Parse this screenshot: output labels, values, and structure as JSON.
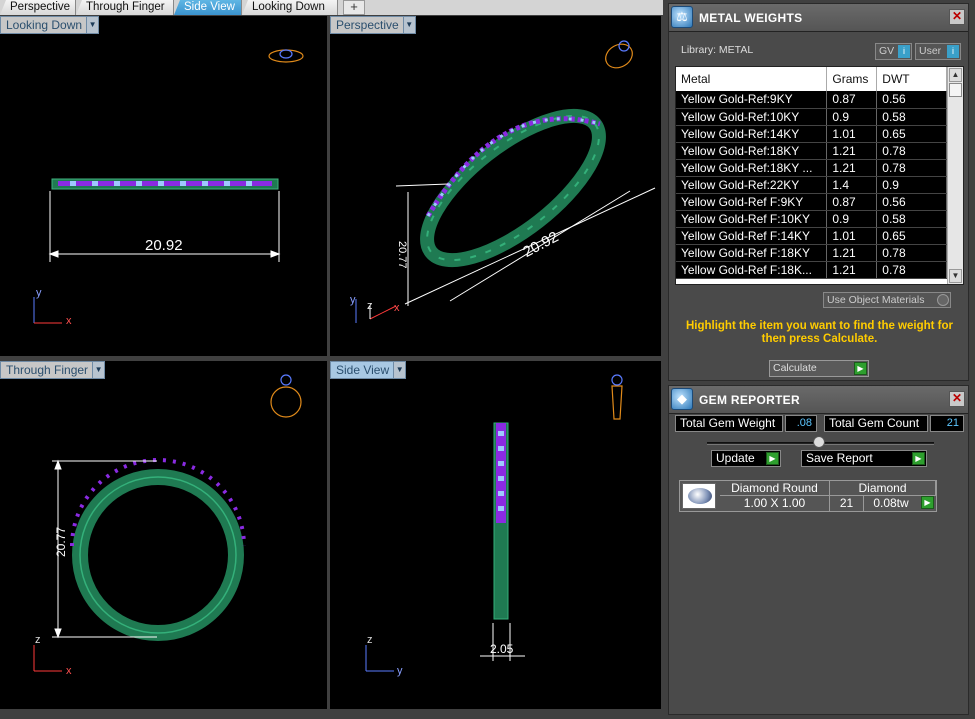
{
  "tabs": [
    {
      "label": "Perspective",
      "active": false
    },
    {
      "label": "Through Finger",
      "active": false
    },
    {
      "label": "Side View",
      "active": true
    },
    {
      "label": "Looking Down",
      "active": false
    }
  ],
  "add_tab_label": "+",
  "viewports": {
    "top_left": {
      "label": "Looking Down",
      "dimension": "20.92",
      "axes": {
        "up": "y",
        "right": "x"
      }
    },
    "top_right": {
      "label": "Perspective",
      "dimension_long": "20.92",
      "dimension_short": "20.77",
      "axes": {
        "up": "y",
        "right": "x",
        "diag": "z"
      }
    },
    "bottom_left": {
      "label": "Through Finger",
      "dimension": "20.77",
      "axes": {
        "up": "z",
        "right": "x"
      }
    },
    "bottom_right": {
      "label": "Side View",
      "dimension": "2.05",
      "axes": {
        "up": "z",
        "right": "y"
      }
    }
  },
  "metal_weights": {
    "title": "METAL WEIGHTS",
    "library_label": "Library: METAL",
    "gv_label": "GV",
    "user_label": "User",
    "columns": [
      "Metal",
      "Grams",
      "DWT"
    ],
    "rows": [
      [
        "Yellow Gold-Ref:9KY",
        "0.87",
        "0.56"
      ],
      [
        "Yellow Gold-Ref:10KY",
        "0.9",
        "0.58"
      ],
      [
        "Yellow Gold-Ref:14KY",
        "1.01",
        "0.65"
      ],
      [
        "Yellow Gold-Ref:18KY",
        "1.21",
        "0.78"
      ],
      [
        "Yellow Gold-Ref:18KY ...",
        "1.21",
        "0.78"
      ],
      [
        "Yellow Gold-Ref:22KY",
        "1.4",
        "0.9"
      ],
      [
        "Yellow Gold-Ref F:9KY",
        "0.87",
        "0.56"
      ],
      [
        "Yellow Gold-Ref F:10KY",
        "0.9",
        "0.58"
      ],
      [
        "Yellow Gold-Ref F:14KY",
        "1.01",
        "0.65"
      ],
      [
        "Yellow Gold-Ref F:18KY",
        "1.21",
        "0.78"
      ],
      [
        "Yellow Gold-Ref F:18K...",
        "1.21",
        "0.78"
      ]
    ],
    "use_object_label": "Use Object Materials",
    "hint": "Highlight the item you want to find the weight for then press Calculate.",
    "calculate_label": "Calculate"
  },
  "gem_reporter": {
    "title": "GEM REPORTER",
    "total_weight_label": "Total Gem Weight",
    "total_weight_value": ".08",
    "total_count_label": "Total Gem Count",
    "total_count_value": "21",
    "update_label": "Update",
    "save_report_label": "Save Report",
    "gem": {
      "name": "Diamond Round",
      "size": "1.00 X 1.00",
      "material": "Diamond",
      "count": "21",
      "weight": "0.08tw"
    }
  },
  "colors": {
    "band": "#1f7a52",
    "band_light": "#2fa874",
    "gem_blue": "#7fb0ff",
    "prong_purple": "#8a2be2",
    "accent_orange": "#e08a1a"
  }
}
